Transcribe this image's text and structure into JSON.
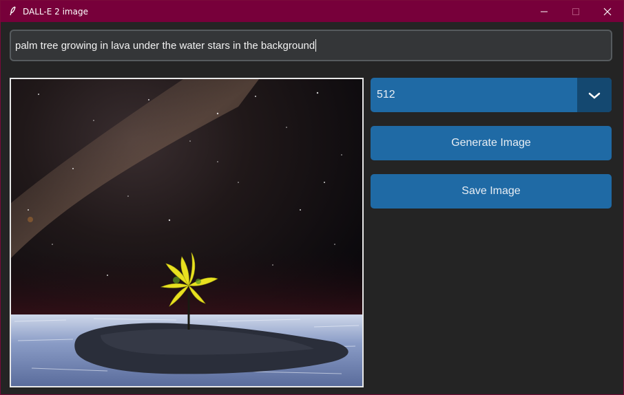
{
  "window": {
    "title": "DALL-E 2 image",
    "icon": "feather-icon",
    "controls": [
      "minimize-icon",
      "maximize-icon",
      "close-icon"
    ]
  },
  "prompt": {
    "value": "palm tree growing in lava under the water stars in the background"
  },
  "size_select": {
    "selected": "512",
    "icon": "chevron-down-icon"
  },
  "actions": {
    "generate_label": "Generate Image",
    "save_label": "Save Image"
  },
  "colors": {
    "titlebar": "#77003a",
    "background": "#242424",
    "button": "#1f6aa5",
    "dropdown_arrow_bg": "#144870",
    "input_bg": "#343638"
  }
}
